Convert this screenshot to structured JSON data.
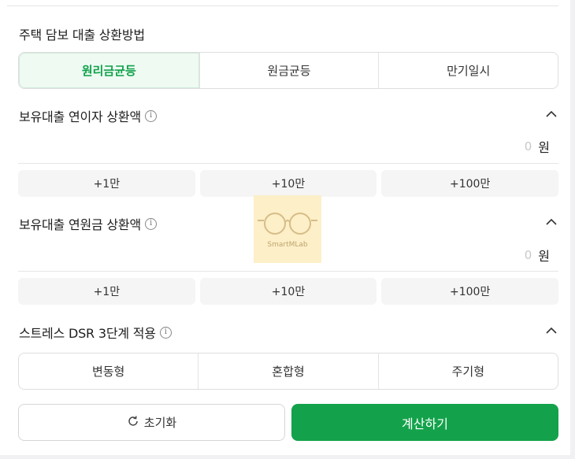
{
  "repayment": {
    "title": "주택 담보 대출 상환방법",
    "options": [
      "원리금균등",
      "원금균등",
      "만기일시"
    ]
  },
  "interest_section": {
    "title": "보유대출 연이자 상환액",
    "value": "0",
    "unit": "원",
    "quick_buttons": [
      "+1만",
      "+10만",
      "+100만"
    ]
  },
  "principal_section": {
    "title": "보유대출 연원금 상환액",
    "value": "0",
    "unit": "원",
    "quick_buttons": [
      "+1만",
      "+10만",
      "+100만"
    ]
  },
  "stress_section": {
    "title": "스트레스 DSR 3단계 적용",
    "options": [
      "변동형",
      "혼합형",
      "주기형"
    ]
  },
  "actions": {
    "reset_label": "초기화",
    "calc_label": "계산하기"
  },
  "watermark": {
    "text": "SmartMLab"
  },
  "colors": {
    "accent": "#13a24b",
    "accent_light": "#effaf3"
  }
}
